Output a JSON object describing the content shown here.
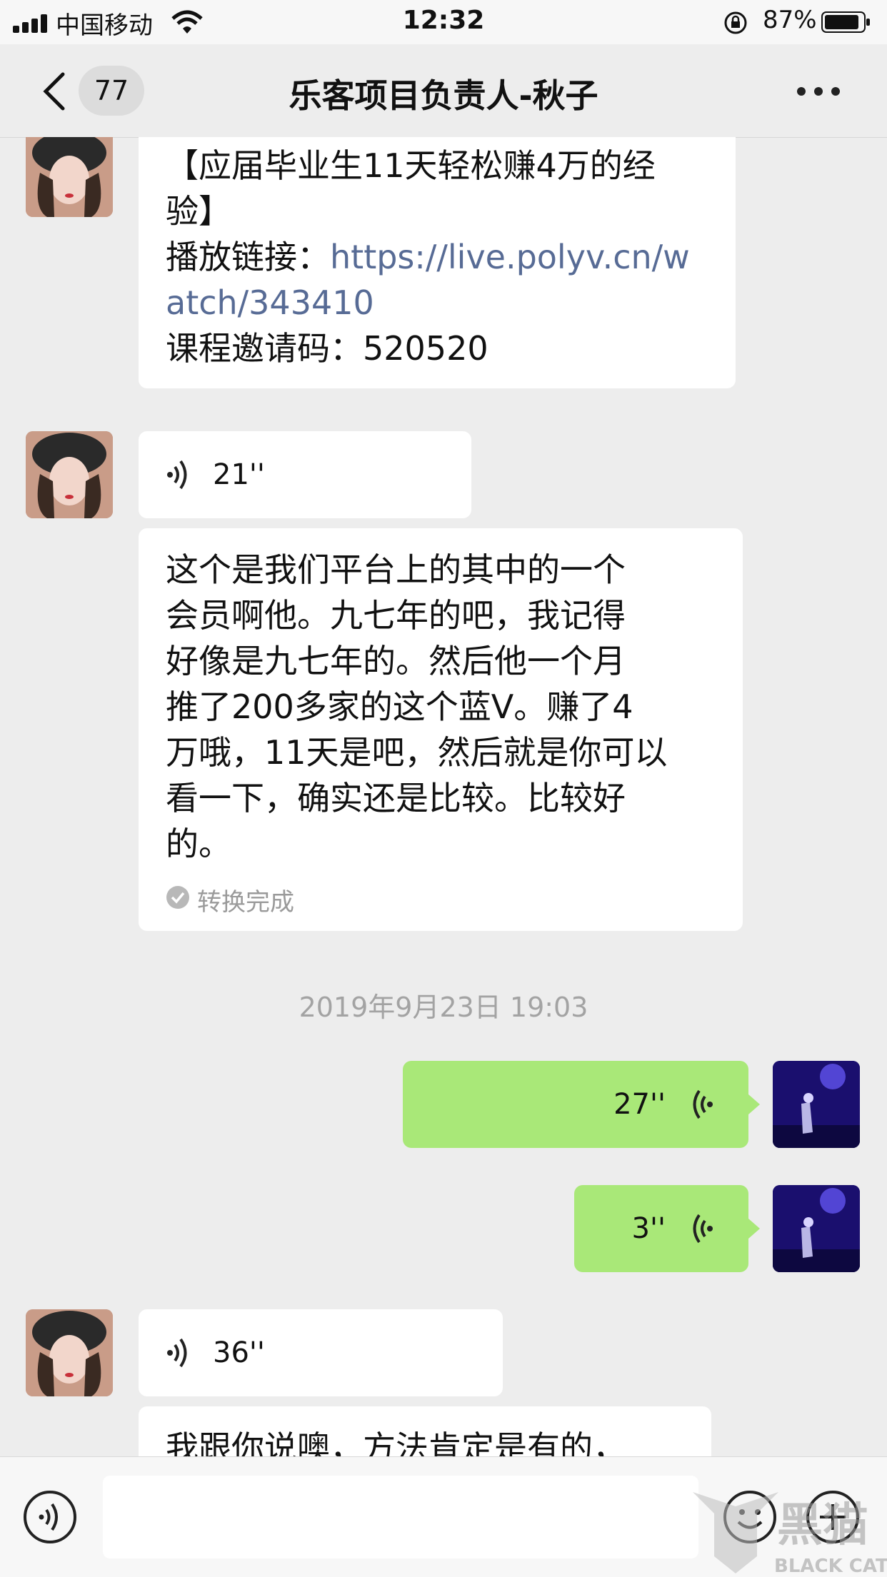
{
  "status_bar": {
    "carrier": "中国移动",
    "time": "12:32",
    "battery_percent": "87%"
  },
  "nav": {
    "unread_count": "77",
    "title": "乐客项目负责人-秋子"
  },
  "messages": [
    {
      "sender": "other",
      "kind": "text",
      "lines": [
        "【应届毕业生11天轻松赚4万的经",
        "验】"
      ],
      "link_prefix": "播放链接：",
      "link": "https://live.polyv.cn/w",
      "link2": "atch/343410",
      "code_line": "课程邀请码：520520"
    },
    {
      "sender": "other",
      "kind": "voice",
      "duration": "21''"
    },
    {
      "sender": "other",
      "kind": "transcript",
      "lines": [
        "这个是我们平台上的其中的一个",
        "会员啊他。九七年的吧，我记得",
        "好像是九七年的。然后他一个月",
        "推了200多家的这个蓝V。赚了4",
        "万哦，11天是吧，然后就是你可以",
        "看一下，确实还是比较。比较好",
        "的。"
      ],
      "status": "转换完成"
    },
    {
      "kind": "timestamp",
      "text": "2019年9月23日 19:03"
    },
    {
      "sender": "me",
      "kind": "voice",
      "duration": "27''"
    },
    {
      "sender": "me",
      "kind": "voice",
      "duration": "3''"
    },
    {
      "sender": "other",
      "kind": "voice",
      "duration": "36''"
    },
    {
      "sender": "other",
      "kind": "text",
      "partial": "我跟你说噢，方法肯定是有的，"
    }
  ],
  "watermark": {
    "text": "BLACK CAT",
    "logo_text": "黑猫"
  },
  "colors": {
    "background": "#ededed",
    "bubble_self": "#a9e878",
    "bubble_other": "#ffffff",
    "link": "#576b95"
  }
}
